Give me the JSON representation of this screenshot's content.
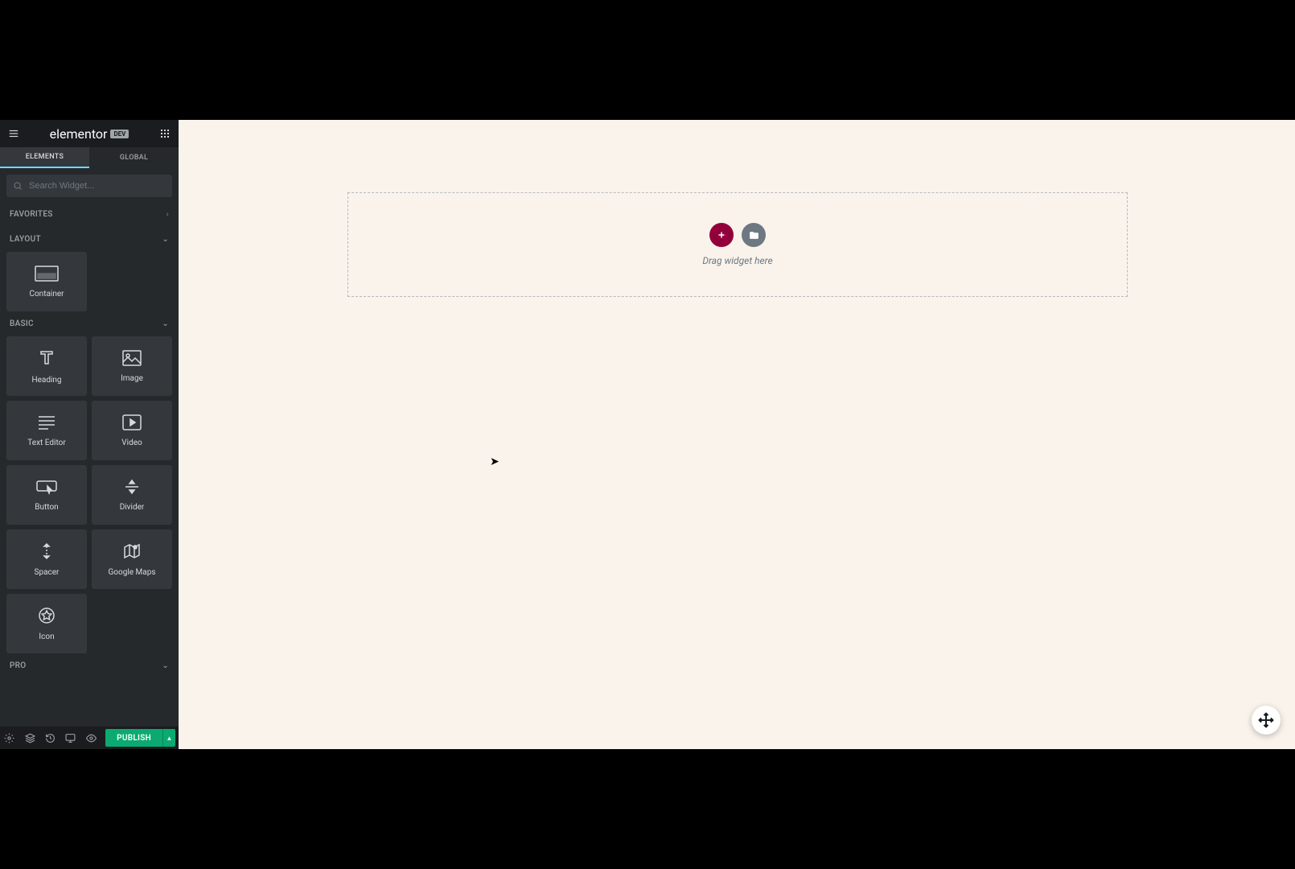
{
  "header": {
    "logo": "elementor",
    "badge": "DEV"
  },
  "tabs": {
    "elements": "ELEMENTS",
    "global": "GLOBAL"
  },
  "search": {
    "placeholder": "Search Widget..."
  },
  "sections": {
    "favorites": "FAVORITES",
    "layout": "LAYOUT",
    "basic": "BASIC",
    "pro": "PRO"
  },
  "widgets": {
    "container": "Container",
    "heading": "Heading",
    "image": "Image",
    "text_editor": "Text Editor",
    "video": "Video",
    "button": "Button",
    "divider": "Divider",
    "spacer": "Spacer",
    "google_maps": "Google Maps",
    "icon": "Icon"
  },
  "canvas": {
    "drag_hint": "Drag widget here"
  },
  "footer": {
    "publish": "PUBLISH"
  }
}
